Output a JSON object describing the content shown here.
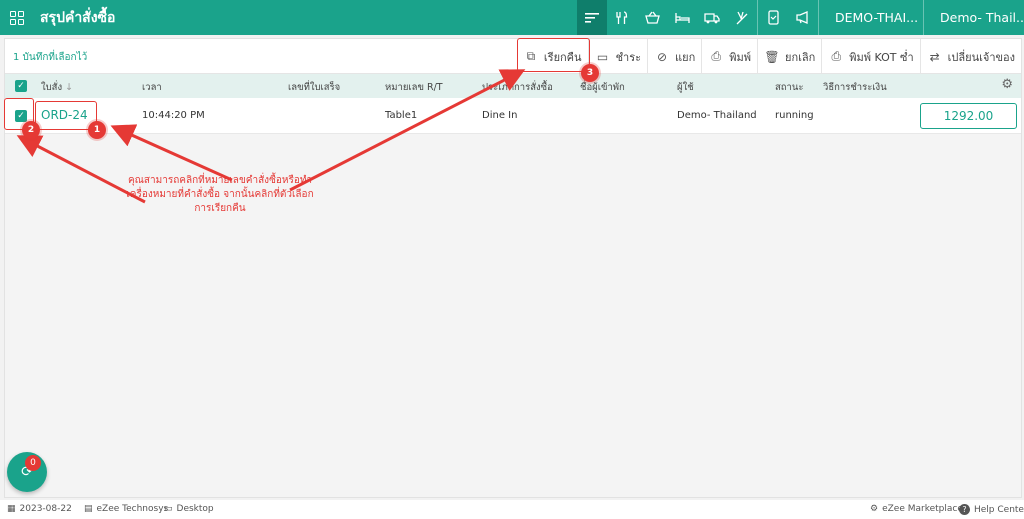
{
  "header": {
    "title": "สรุปคำสั่งซื้อ",
    "location": "DEMO-THAI...",
    "user": "Demo- Thail..."
  },
  "toolbar": {
    "selected_count": "1 บันทึกที่เลือกไว้",
    "actions": [
      {
        "label": "เรียกคืน",
        "icon": "external-link-icon"
      },
      {
        "label": "ชำระ",
        "icon": "credit-card-icon"
      },
      {
        "label": "แยก",
        "icon": "split-icon"
      },
      {
        "label": "พิมพ์",
        "icon": "printer-icon"
      },
      {
        "label": "ยกเลิก",
        "icon": "trash-icon"
      },
      {
        "label": "พิมพ์ KOT ซ่ำ",
        "icon": "printer-repeat-icon"
      },
      {
        "label": "เปลี่ยนเจ้าของ",
        "icon": "swap-icon"
      }
    ]
  },
  "table": {
    "columns": [
      "ใบสั่ง",
      "เวลา",
      "เลขที่ใบเสร็จ",
      "หมายเลข R/T",
      "ประเภทการสั่งซื้อ",
      "ชื่อผู้เข้าพัก",
      "ผู้ใช้",
      "สถานะ",
      "วิธีการชำระเงิน"
    ],
    "rows": [
      {
        "order": "ORD-24",
        "time": "10:44:20 PM",
        "receipt": "",
        "rt": "Table1",
        "order_type": "Dine In",
        "guest": "",
        "user": "Demo- Thailand",
        "status": "running",
        "payment": "",
        "amount": "1292.00"
      }
    ]
  },
  "annotation": {
    "text": "คุณสามารถคลิกที่หมายเลขคำสั่งซื้อหรือทำเครื่องหมายที่คำสั่งซื้อ จากนั้นคลิกที่ตัวเลือกการเรียกคืน",
    "badges": [
      "1",
      "2",
      "3"
    ],
    "color": "#e53935"
  },
  "fab": {
    "badge": "0"
  },
  "footer": {
    "date": "2023-08-22",
    "company": "eZee Technosys",
    "device": "Desktop",
    "marketplace": "eZee Marketplace",
    "help": "Help Center"
  },
  "colors": {
    "brand": "#1aa38b",
    "brand_dark": "#0f7e6b",
    "annotation": "#e53935"
  }
}
